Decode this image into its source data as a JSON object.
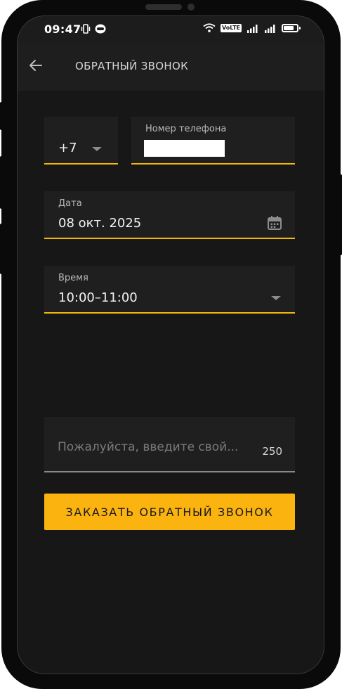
{
  "statusbar": {
    "time": "09:47",
    "volte": "VoLTE",
    "icons": [
      "vibrate-icon",
      "app-icon",
      "wifi-icon",
      "volte-icon",
      "signal-icon",
      "signal-icon",
      "battery-icon"
    ],
    "battery_level": 0.75
  },
  "appbar": {
    "title": "ОБРАТНЫЙ ЗВОНОК",
    "back_icon": "arrow-left-icon"
  },
  "form": {
    "country_code": "+7",
    "phone_label": "Номер телефона",
    "date_label": "Дата",
    "date_value": "08 окт. 2025",
    "time_label": "Время",
    "time_value": "10:00–11:00",
    "comment_placeholder": "Пожалуйста, введите свой...",
    "comment_counter": "250",
    "submit_label": "ЗАКАЗАТЬ ОБРАТНЫЙ ЗВОНОК"
  },
  "colors": {
    "accent": "#fbb40f",
    "underline": "#f5b80a",
    "background": "#171717",
    "field": "#1f1f1f"
  }
}
